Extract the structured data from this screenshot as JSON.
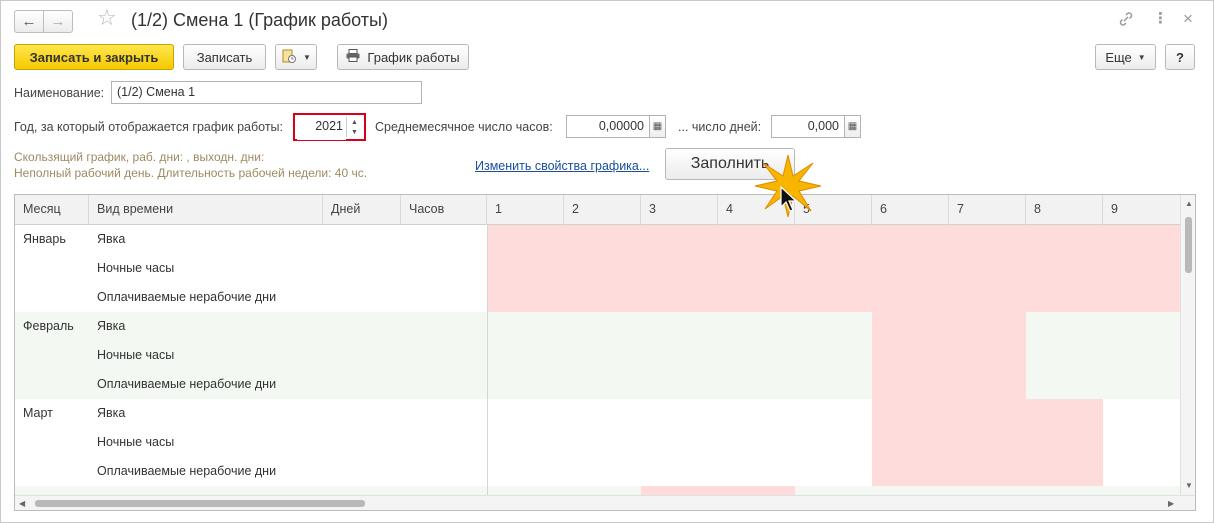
{
  "window": {
    "title": "(1/2) Смена 1 (График работы)"
  },
  "toolbar": {
    "save_close_label": "Записать и закрыть",
    "save_label": "Записать",
    "print_label": "График работы",
    "more_label": "Еще",
    "help_label": "?"
  },
  "form": {
    "name_label": "Наименование:",
    "name_value": "(1/2) Смена 1",
    "year_label": "Год, за который отображается график работы:",
    "year_value": "2021",
    "avg_hours_label": "Среднемесячное число часов:",
    "avg_hours_value": "0,00000",
    "days_label": "... число дней:",
    "days_value": "0,000",
    "info_line1": "Скользящий график, раб. дни: , выходн. дни:",
    "info_line2": "Неполный рабочий день. Длительность рабочей недели: 40 чс.",
    "change_link": "Изменить свойства графика...",
    "fill_button": "Заполнить"
  },
  "table": {
    "headers": {
      "month": "Месяц",
      "time_type": "Вид времени",
      "days": "Дней",
      "hours": "Часов",
      "day_numbers": [
        "1",
        "2",
        "3",
        "4",
        "5",
        "6",
        "7",
        "8",
        "9"
      ]
    },
    "rows": [
      {
        "month": "Январь",
        "time_type": "Явка"
      },
      {
        "month": "",
        "time_type": "Ночные часы"
      },
      {
        "month": "",
        "time_type": "Оплачиваемые нерабочие дни"
      },
      {
        "month": "Февраль",
        "time_type": "Явка"
      },
      {
        "month": "",
        "time_type": "Ночные часы"
      },
      {
        "month": "",
        "time_type": "Оплачиваемые нерабочие дни"
      },
      {
        "month": "Март",
        "time_type": "Явка"
      },
      {
        "month": "",
        "time_type": "Ночные часы"
      },
      {
        "month": "",
        "time_type": "Оплачиваемые нерабочие дни"
      }
    ]
  },
  "colors": {
    "holiday": "#ffdcdc",
    "alt_row": "#f3f8f3",
    "accent_yellow": "#f6c800",
    "highlight_red": "#d6001c"
  }
}
